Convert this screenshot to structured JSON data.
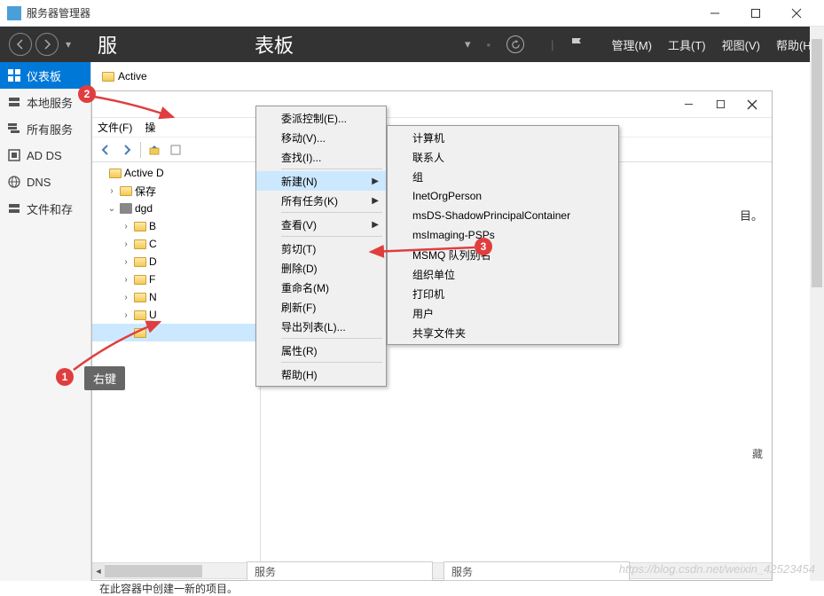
{
  "titlebar": {
    "title": "服务器管理器"
  },
  "darkHeader": {
    "titleLeft": "服",
    "titleRight": "表板",
    "menu": {
      "manage": "管理(M)",
      "tools": "工具(T)",
      "view": "视图(V)",
      "help": "帮助(H)"
    }
  },
  "sidebar": {
    "items": [
      {
        "label": "仪表板"
      },
      {
        "label": "本地服务"
      },
      {
        "label": "所有服务"
      },
      {
        "label": "AD DS"
      },
      {
        "label": "DNS"
      },
      {
        "label": "文件和存"
      }
    ]
  },
  "topStrip": {
    "label": "Active"
  },
  "innerWindow": {
    "menubar": {
      "file": "文件(F)",
      "ops": "操"
    },
    "tree": {
      "root": "Active D",
      "n1": "保存",
      "n2": "dgd",
      "c1": "B",
      "c2": "C",
      "c3": "D",
      "c4": "F",
      "c5": "N",
      "c6": "U",
      "sel": ""
    },
    "rightText": "目。",
    "sideText": "藏",
    "status": "在此容器中创建一新的项目。"
  },
  "contextMenu1": {
    "items": [
      "委派控制(E)...",
      "移动(V)...",
      "查找(I)...",
      "新建(N)",
      "所有任务(K)",
      "查看(V)",
      "剪切(T)",
      "删除(D)",
      "重命名(M)",
      "刷新(F)",
      "导出列表(L)...",
      "属性(R)",
      "帮助(H)"
    ]
  },
  "contextMenu2": {
    "items": [
      "计算机",
      "联系人",
      "组",
      "InetOrgPerson",
      "msDS-ShadowPrincipalContainer",
      "msImaging-PSPs",
      "MSMQ 队列别名",
      "组织单位",
      "打印机",
      "用户",
      "共享文件夹"
    ]
  },
  "annotations": {
    "a1": "1",
    "a2": "2",
    "a3": "3",
    "tooltip": "右键"
  },
  "bottom": {
    "frag1": "服务",
    "frag2": "服务"
  },
  "watermark": "https://blog.csdn.net/weixin_42523454"
}
